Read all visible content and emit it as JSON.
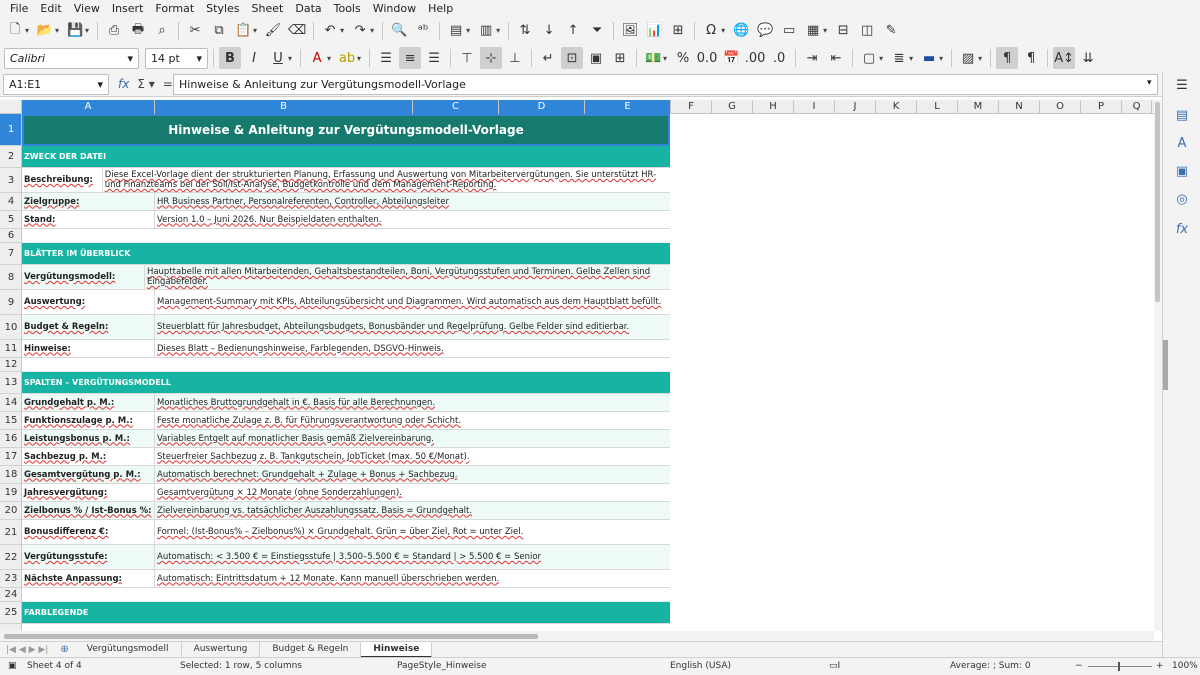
{
  "menu": [
    "File",
    "Edit",
    "View",
    "Insert",
    "Format",
    "Styles",
    "Sheet",
    "Data",
    "Tools",
    "Window",
    "Help"
  ],
  "font": {
    "name": "Calibri",
    "size": "14 pt"
  },
  "namebox": "A1:E1",
  "formula": "Hinweise & Anleitung zur Vergütungsmodell-Vorlage",
  "columns": [
    "A",
    "B",
    "C",
    "D",
    "E",
    "F",
    "G",
    "H",
    "I",
    "J",
    "K",
    "L",
    "M",
    "N",
    "O",
    "P",
    "Q"
  ],
  "rows": [
    {
      "n": "1",
      "kind": "title",
      "label": "Hinweise & Anleitung zur Vergütungsmodell-Vorlage"
    },
    {
      "n": "2",
      "kind": "sec",
      "label": "ZWECK DER DATEI"
    },
    {
      "n": "3",
      "kind": "item",
      "label": "Beschreibung:",
      "value": "Diese Excel-Vorlage dient der strukturierten Planung, Erfassung und Auswertung von Mitarbeitervergütungen. Sie unterstützt HR- und Finanzteams bei der Soll/Ist-Analyse, Budgetkontrolle und dem Management-Reporting."
    },
    {
      "n": "4",
      "kind": "item",
      "label": "Zielgruppe:",
      "value": "HR Business Partner, Personalreferenten, Controller, Abteilungsleiter"
    },
    {
      "n": "5",
      "kind": "item",
      "label": "Stand:",
      "value": "Version 1.0 – Juni 2026. Nur Beispieldaten enthalten."
    },
    {
      "n": "6",
      "kind": "blank"
    },
    {
      "n": "7",
      "kind": "sec",
      "label": "BLÄTTER IM ÜBERBLICK"
    },
    {
      "n": "8",
      "kind": "item",
      "label": "Vergütungsmodell:",
      "value": "Haupttabelle mit allen Mitarbeitenden, Gehaltsbestandteilen, Boni, Vergütungsstufen und Terminen. Gelbe Zellen sind Eingabefelder."
    },
    {
      "n": "9",
      "kind": "item",
      "label": "Auswertung:",
      "value": "Management-Summary mit KPIs, Abteilungsübersicht und Diagrammen. Wird automatisch aus dem Hauptblatt befüllt."
    },
    {
      "n": "10",
      "kind": "item",
      "label": "Budget & Regeln:",
      "value": "Steuerblatt für Jahresbudget, Abteilungsbudgets, Bonusbänder und Regelprüfung. Gelbe Felder sind editierbar."
    },
    {
      "n": "11",
      "kind": "item",
      "label": "Hinweise:",
      "value": "Dieses Blatt – Bedienungshinweise, Farblegenden, DSGVO-Hinweis."
    },
    {
      "n": "12",
      "kind": "blank"
    },
    {
      "n": "13",
      "kind": "sec",
      "label": "SPALTEN – VERGÜTUNGSMODELL"
    },
    {
      "n": "14",
      "kind": "item",
      "label": "Grundgehalt p. M.:",
      "value": "Monatliches Bruttogrundgehalt in €. Basis für alle Berechnungen."
    },
    {
      "n": "15",
      "kind": "item",
      "label": "Funktionszulage p. M.:",
      "value": "Feste monatliche Zulage z. B. für Führungsverantwortung oder Schicht."
    },
    {
      "n": "16",
      "kind": "item",
      "label": "Leistungsbonus p. M.:",
      "value": "Variables Entgelt auf monatlicher Basis gemäß Zielvereinbarung."
    },
    {
      "n": "17",
      "kind": "item",
      "label": "Sachbezug p. M.:",
      "value": "Steuerfreier Sachbezug z. B. Tankgutschein, JobTicket (max. 50 €/Monat)."
    },
    {
      "n": "18",
      "kind": "item",
      "label": "Gesamtvergütung p. M.:",
      "value": "Automatisch berechnet: Grundgehalt + Zulage + Bonus + Sachbezug."
    },
    {
      "n": "19",
      "kind": "item",
      "label": "Jahresvergütung:",
      "value": "Gesamtvergütung × 12 Monate (ohne Sonderzahlungen)."
    },
    {
      "n": "20",
      "kind": "item",
      "label": "Zielbonus % / Ist-Bonus %:",
      "value": "Zielvereinbarung vs. tatsächlicher Auszahlungssatz. Basis = Grundgehalt."
    },
    {
      "n": "21",
      "kind": "item",
      "label": "Bonusdifferenz €:",
      "value": "Formel: (Ist-Bonus% – Zielbonus%) × Grundgehalt. Grün = über Ziel, Rot = unter Ziel."
    },
    {
      "n": "22",
      "kind": "item",
      "label": "Vergütungsstufe:",
      "value": "Automatisch: < 3.500 € = Einstiegsstufe | 3.500–5.500 € = Standard | > 5.500 € = Senior"
    },
    {
      "n": "23",
      "kind": "item",
      "label": "Nächste Anpassung:",
      "value": "Automatisch: Eintrittsdatum + 12 Monate. Kann manuell überschrieben werden."
    },
    {
      "n": "24",
      "kind": "blank"
    },
    {
      "n": "25",
      "kind": "sec",
      "label": "FARBLEGENDE"
    }
  ],
  "tabs": [
    "Vergütungsmodell",
    "Auswertung",
    "Budget & Regeln",
    "Hinweise"
  ],
  "status": {
    "sheet": "Sheet 4 of 4",
    "selection": "Selected: 1 row, 5 columns",
    "pagestyle": "PageStyle_Hinweise",
    "lang": "English (USA)",
    "sum": "Average: ; Sum: 0",
    "zoom": "100%"
  }
}
